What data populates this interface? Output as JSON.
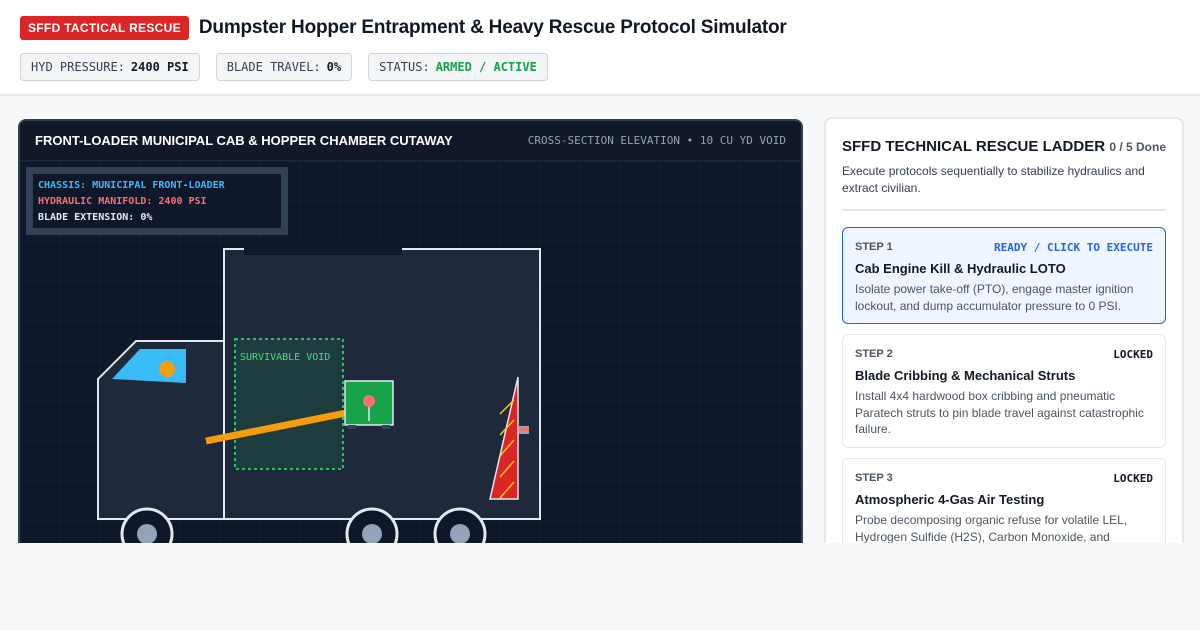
{
  "header": {
    "badge": "SFFD TACTICAL RESCUE",
    "title": "Dumpster Hopper Entrapment & Heavy Rescue Protocol Simulator",
    "chips": [
      {
        "label": "HYD PRESSURE:",
        "value": "2400 PSI"
      },
      {
        "label": "BLADE TRAVEL:",
        "value": "0%"
      },
      {
        "label": "STATUS:",
        "value": "ARMED / ACTIVE"
      }
    ]
  },
  "scene": {
    "title": "FRONT-LOADER MUNICIPAL CAB & HOPPER CHAMBER CUTAWAY",
    "subtitle": "CROSS-SECTION ELEVATION • 10 CU YD VOID",
    "readout": {
      "chassis": "CHASSIS: MUNICIPAL FRONT-LOADER",
      "manifold": "HYDRAULIC MANIFOLD: 2400 PSI",
      "blade": "BLADE EXTENSION: 0%"
    },
    "void_label": "SURVIVABLE VOID",
    "blade_extension_pct": 0,
    "colors": {
      "void": "#22c55e",
      "blade": "#dc2626",
      "arm": "#f59e0b",
      "windshield": "#38bdf8"
    }
  },
  "ladder": {
    "title": "SFFD TECHNICAL RESCUE LADDER",
    "count": "0 / 5 Done",
    "description": "Execute protocols sequentially to stabilize hydraulics and extract civilian.",
    "steps": [
      {
        "num": "STEP 1",
        "state": "READY / CLICK TO EXECUTE",
        "name": "Cab Engine Kill & Hydraulic LOTO",
        "text": "Isolate power take-off (PTO), engage master ignition lockout, and dump accumulator pressure to 0 PSI."
      },
      {
        "num": "STEP 2",
        "state": "LOCKED",
        "name": "Blade Cribbing & Mechanical Struts",
        "text": "Install 4x4 hardwood box cribbing and pneumatic Paratech struts to pin blade travel against catastrophic failure."
      },
      {
        "num": "STEP 3",
        "state": "LOCKED",
        "name": "Atmospheric 4-Gas Air Testing",
        "text": "Probe decomposing organic refuse for volatile LEL, Hydrogen Sulfide (H2S), Carbon Monoxide, and"
      }
    ]
  }
}
